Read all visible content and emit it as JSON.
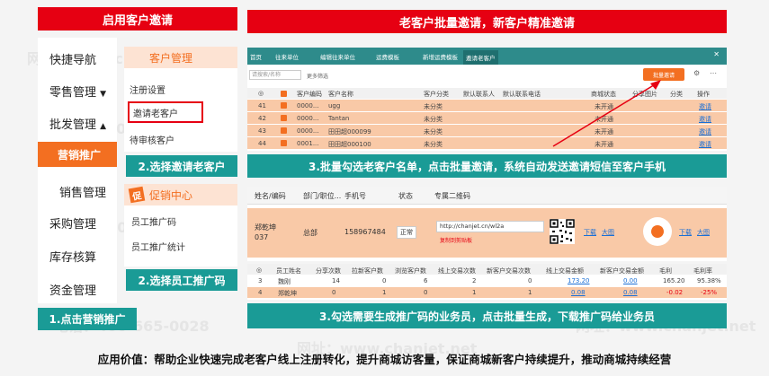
{
  "headers": {
    "left": "启用客户邀请",
    "right": "老客户批量邀请，新客户精准邀请"
  },
  "nav": {
    "items": [
      "快捷导航",
      "零售管理",
      "批发管理",
      "营销推广",
      "销售管理",
      "采购管理",
      "库存核算",
      "资金管理"
    ],
    "arrow_down": "▼",
    "arrow_up": "▲"
  },
  "customer_menu": {
    "title": "客户管理",
    "items": [
      "注册设置",
      "邀请老客户",
      "待审核客户"
    ]
  },
  "promo_menu": {
    "title": "促销中心",
    "items": [
      "员工推广码",
      "员工推广统计"
    ]
  },
  "steps": {
    "s1": "1.点击营销推广",
    "s2a": "2.选择邀请老客户",
    "s2b": "2.选择员工推广码",
    "s3a": "3.批量勾选老客户名单，点击批量邀请，系统自动发送邀请短信至客户手机",
    "s3b": "3.勾选需要生成推广码的业务员，点击批量生成，下载推广码给业务员"
  },
  "app_window": {
    "tabs": [
      "首页",
      "往来单位",
      "编辑往来单位",
      "运费模板",
      "新增运费模板",
      "邀请老客户"
    ],
    "search_placeholder": "请搜索/名称",
    "more_filter": "更多筛选",
    "batch_invite": "批量邀请",
    "columns": [
      "客户编码",
      "客户名称",
      "客户分类",
      "默认联系人",
      "默认联系电话",
      "商城状态",
      "分享图片",
      "分类",
      "操作"
    ],
    "rows": [
      {
        "no": "41",
        "code": "0000...",
        "name": "ugg",
        "cat": "未分类",
        "status": "未开通",
        "op": "邀请"
      },
      {
        "no": "42",
        "code": "0000...",
        "name": "Tantan",
        "cat": "未分类",
        "status": "未开通",
        "op": "邀请"
      },
      {
        "no": "43",
        "code": "0000...",
        "name": "田田超000099",
        "cat": "未分类",
        "status": "未开通",
        "op": "邀请"
      },
      {
        "no": "44",
        "code": "0001...",
        "name": "田田超000100",
        "cat": "未分类",
        "status": "未开通",
        "op": "邀请"
      }
    ]
  },
  "promo_table": {
    "columns": [
      "姓名/编码",
      "部门/职位...",
      "手机号",
      "状态",
      "专属二维码"
    ],
    "row": {
      "name": "郑乾坤",
      "code": "037",
      "dept": "总部",
      "phone": "158967484",
      "status": "正常",
      "url": "http://chanjet.cn/wl2a",
      "copy": "复制到剪贴板",
      "download1": "下载",
      "enlarge1": "大图",
      "download2": "下载",
      "enlarge2": "大图"
    }
  },
  "stats_table": {
    "columns": [
      "员工姓名",
      "分享次数",
      "拉新客户数",
      "浏览客户数",
      "线上交易次数",
      "新客户交易次数",
      "线上交易金额",
      "新客户交易金额",
      "毛利",
      "毛利率"
    ],
    "rows": [
      {
        "no": "3",
        "name": "魏刚",
        "share": "14",
        "new": "0",
        "browse": "6",
        "trades": "2",
        "newtrades": "0",
        "amount": "173.20",
        "newamount": "0.00",
        "profit": "165.20",
        "rate": "95.38%"
      },
      {
        "no": "4",
        "name": "郑乾坤",
        "share": "0",
        "new": "1",
        "browse": "0",
        "trades": "1",
        "newtrades": "1",
        "amount": "0.08",
        "newamount": "0.08",
        "profit": "-0.02",
        "rate": "-25%"
      }
    ]
  },
  "footer": "应用价值：帮助企业快速完成老客户线上注册转化，提升商城访客量，保证商城新客户持续提升，推动商城持续经营",
  "watermarks": [
    "网址：www.chanjet.net",
    "电话：400-665-0028"
  ],
  "colors": {
    "red": "#e60012",
    "teal": "#1a9b96",
    "orange": "#f36f21",
    "app_blue": "#2e8b8b"
  }
}
